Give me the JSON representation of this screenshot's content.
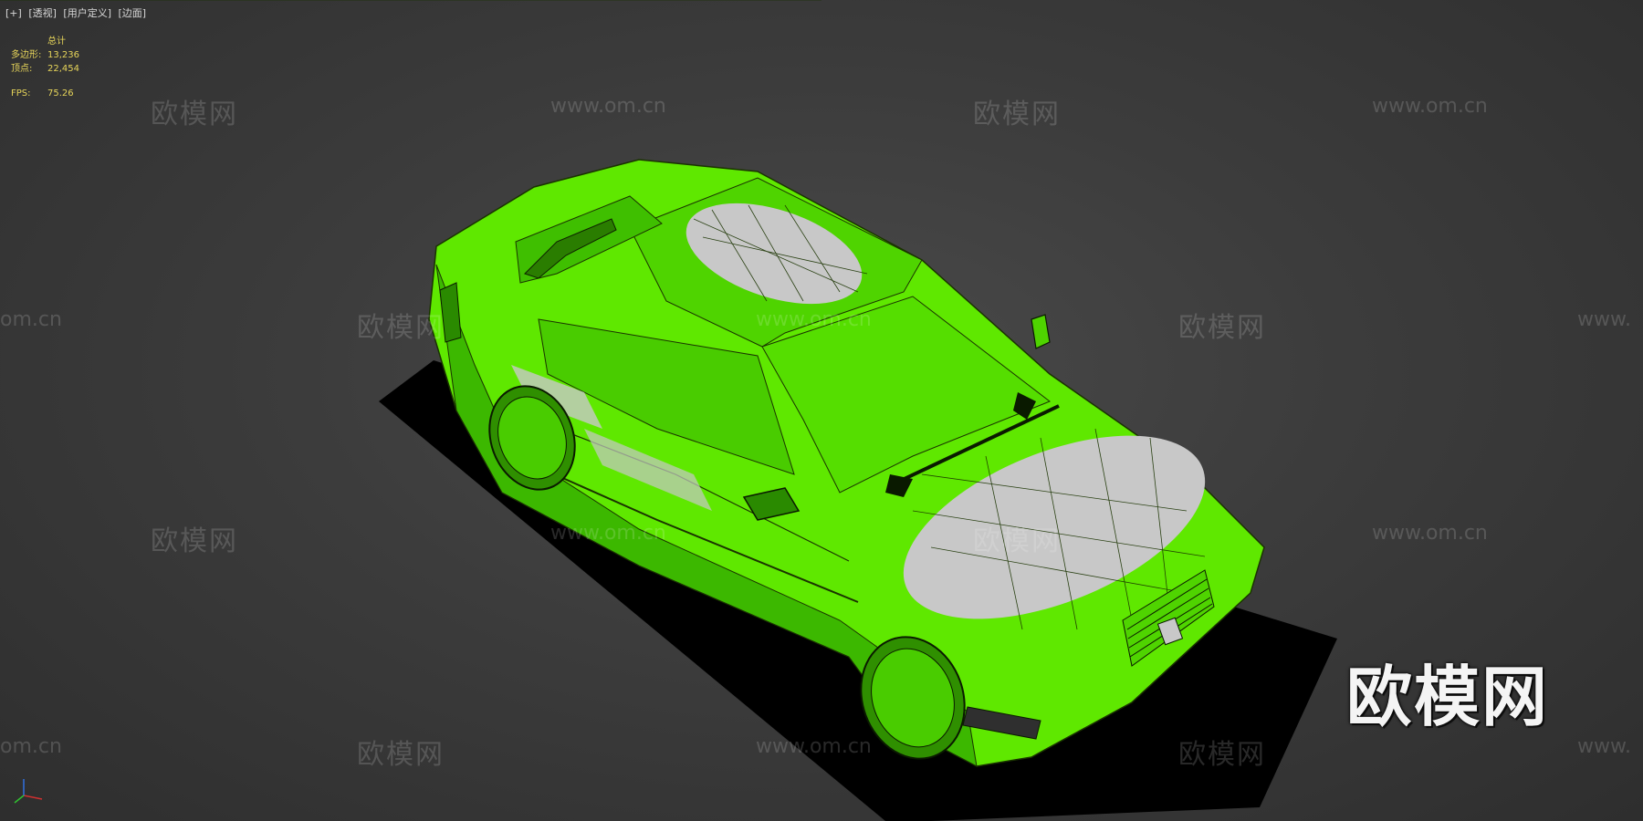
{
  "viewport": {
    "labels": [
      "[+]",
      "[透视]",
      "[用户定义]",
      "[边面]"
    ]
  },
  "stats": {
    "header": "总计",
    "polygons_label": "多边形:",
    "polygons_value": "13,236",
    "vertices_label": "顶点:",
    "vertices_value": "22,454",
    "fps_label": "FPS:",
    "fps_value": "75.26"
  },
  "watermarks": {
    "cn": "欧模网",
    "url": "www.om.cn",
    "url_short": "om.cn",
    "url_prefix": "www."
  },
  "colors": {
    "car_body": "#5fe800",
    "car_shade": "#3cb800",
    "unwrapped_patch": "#c8c8c8",
    "shadow": "#000000",
    "stats_text": "#e6d45a"
  },
  "icons": {
    "axis_gizmo": "xyz-axis-icon"
  }
}
